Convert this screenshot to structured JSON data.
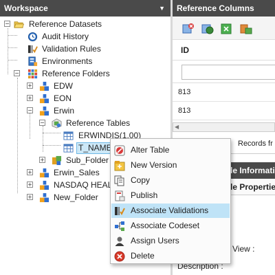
{
  "workspace": {
    "title": "Workspace",
    "tree": {
      "reference_datasets": "Reference Datasets",
      "audit_history": "Audit History",
      "validation_rules": "Validation Rules",
      "environments": "Environments",
      "reference_folders": "Reference Folders",
      "edw": "EDW",
      "eon": "EON",
      "erwin": "Erwin",
      "reference_tables": "Reference Tables",
      "erwindis": "ERWINDIS(1.00)",
      "t_name": "T_NAME(",
      "sub_folder": "Sub_Folder",
      "erwin_sales": "Erwin_Sales",
      "nasdaq": "NASDAQ HEALT",
      "new_folder": "New_Folder"
    }
  },
  "reference_columns": {
    "title": "Reference Columns",
    "column_header": "ID",
    "filter_placeholder": "",
    "rows": [
      "813",
      "813"
    ],
    "pager_text": "Records fr"
  },
  "table_info": {
    "header": "le Informatio",
    "tab": "le Properties"
  },
  "properties": {
    "view_label": "View :",
    "description_label": "Description :"
  },
  "context_menu": {
    "items": [
      {
        "label": "Alter Table",
        "icon": "alter-table-icon"
      },
      {
        "label": "New Version",
        "icon": "new-version-icon"
      },
      {
        "label": "Copy",
        "icon": "copy-icon"
      },
      {
        "label": "Publish",
        "icon": "publish-icon"
      },
      {
        "label": "Associate Validations",
        "icon": "associate-validations-icon"
      },
      {
        "label": "Associate Codeset",
        "icon": "associate-codeset-icon"
      },
      {
        "label": "Assign Users",
        "icon": "assign-users-icon"
      },
      {
        "label": "Delete",
        "icon": "delete-icon"
      }
    ],
    "highlighted": "Associate Validations"
  },
  "colors": {
    "header_bg": "#4a4a4a",
    "selection_bg": "#cde8f7",
    "menu_hover_bg": "#bfe3f7"
  }
}
